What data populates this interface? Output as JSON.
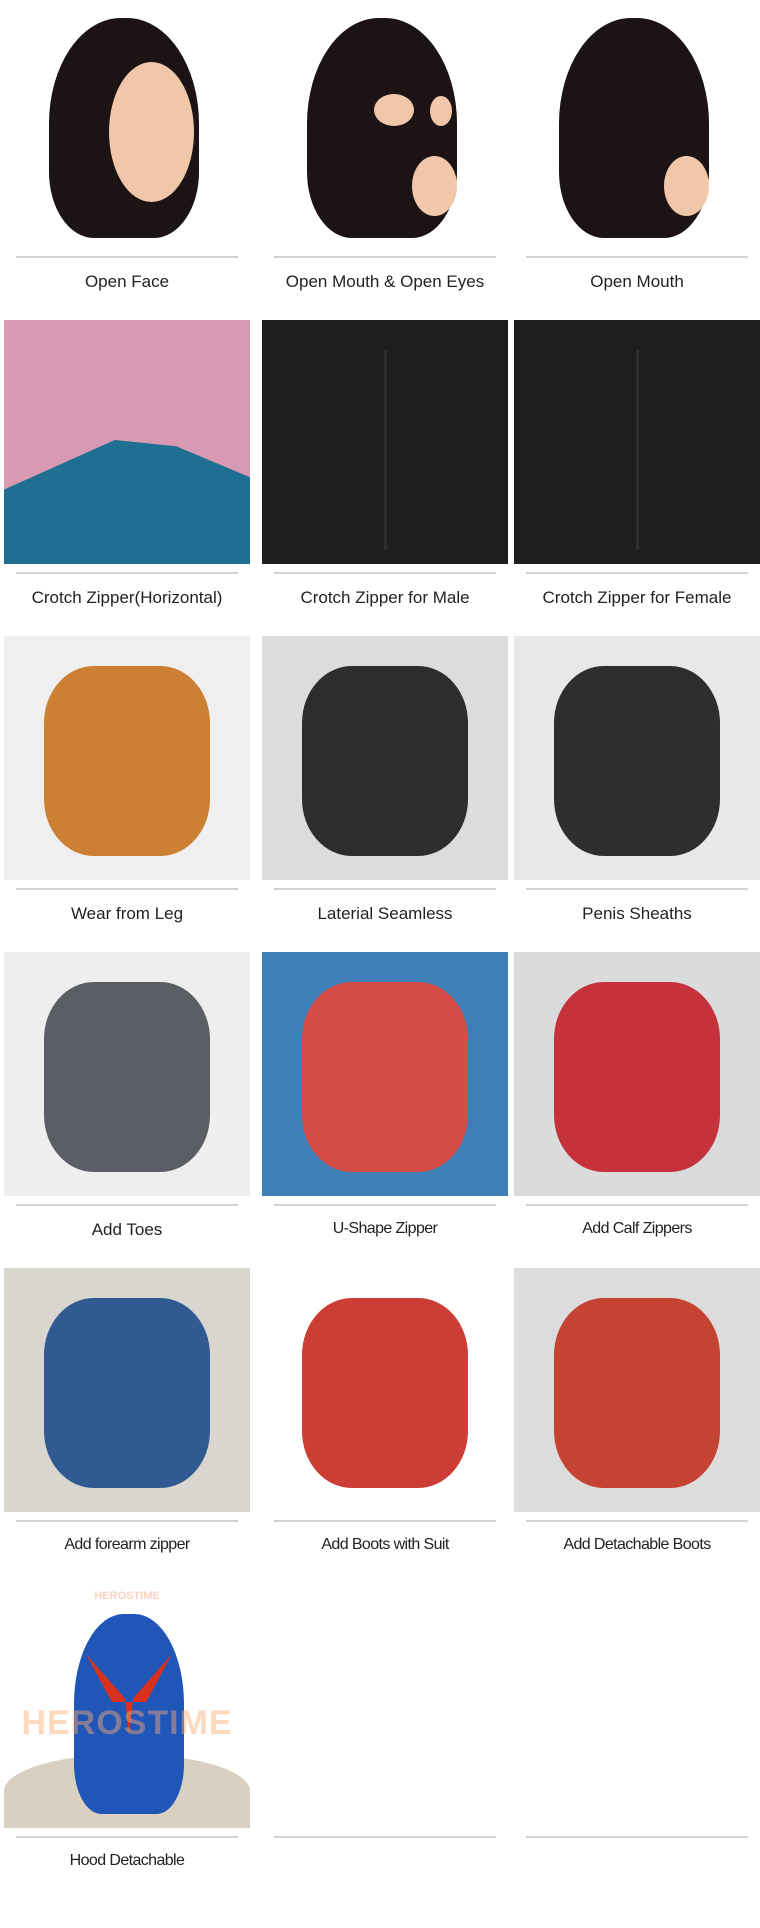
{
  "items": [
    {
      "caption": "Open Face",
      "icon": "hood-open-face-image",
      "bg": "#ffffff",
      "fg": "#1c1414",
      "skin": "#f0c7a8"
    },
    {
      "caption": "Open Mouth & Open Eyes",
      "icon": "hood-open-mouth-eyes-image",
      "bg": "#ffffff",
      "fg": "#1c1414",
      "skin": "#f0c7a8"
    },
    {
      "caption": "Open Mouth",
      "icon": "hood-open-mouth-image",
      "bg": "#ffffff",
      "fg": "#1c1414",
      "skin": "#f0c7a8"
    },
    {
      "caption": "Crotch Zipper(Horizontal)",
      "icon": "crotch-zipper-horizontal-image",
      "bg": "#d79ab2",
      "fg": "#1f6f92"
    },
    {
      "caption": "Crotch Zipper for Male",
      "icon": "crotch-zipper-male-image",
      "bg": "#1e1e1e",
      "fg": "#2e2e2e"
    },
    {
      "caption": "Crotch Zipper for Female",
      "icon": "crotch-zipper-female-image",
      "bg": "#1e1e1e",
      "fg": "#2e2e2e"
    },
    {
      "caption": "Wear  from Leg",
      "icon": "wear-from-leg-image",
      "bg": "#efefef",
      "fg": "#c8731f"
    },
    {
      "caption": "Laterial Seamless",
      "icon": "laterial-seamless-image",
      "bg": "#dcdcdc",
      "fg": "#1a1a1a"
    },
    {
      "caption": "Penis Sheaths",
      "icon": "penis-sheaths-image",
      "bg": "#e8e8e8",
      "fg": "#1a1a1a"
    },
    {
      "caption": "Add Toes",
      "icon": "add-toes-image",
      "bg": "#eeeeee",
      "fg": "#4a4f55"
    },
    {
      "caption": "U-Shape Zipper",
      "icon": "u-shape-zipper-image",
      "bg": "#3f7fb8",
      "fg": "#e5473a"
    },
    {
      "caption": "Add Calf Zippers",
      "icon": "add-calf-zippers-image",
      "bg": "#d9dbdc",
      "fg": "#c21f2a"
    },
    {
      "caption": "Add forearm zipper",
      "icon": "add-forearm-zipper-image",
      "bg": "#d8d6cf",
      "fg": "#1f4d8c"
    },
    {
      "caption": "Add Boots with Suit",
      "icon": "add-boots-with-suit-image",
      "bg": "#ffffff",
      "fg": "#c5281f"
    },
    {
      "caption": "Add Detachable Boots",
      "icon": "add-detachable-boots-image",
      "bg": "#dcdcdc",
      "fg": "#c2321f"
    },
    {
      "caption": "Hood Detachable",
      "icon": "hood-detachable-image",
      "bg": "#ffffff",
      "fg": "#1f56b8",
      "watermark": "HEROSTIME"
    },
    {
      "caption": "",
      "icon": "",
      "bg": "#ffffff",
      "fg": "#ffffff"
    },
    {
      "caption": "",
      "icon": "",
      "bg": "#ffffff",
      "fg": "#ffffff"
    }
  ]
}
